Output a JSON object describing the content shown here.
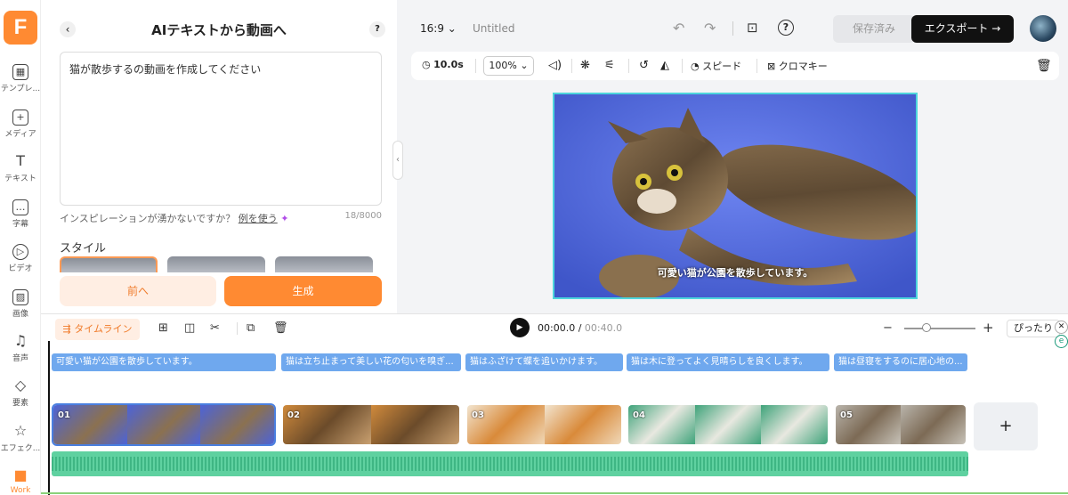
{
  "rail": {
    "items": [
      {
        "label": "テンプレ...",
        "icon": "template-icon",
        "glyph": "▦"
      },
      {
        "label": "メディア",
        "icon": "media-add-icon",
        "glyph": "+"
      },
      {
        "label": "テキスト",
        "icon": "text-icon",
        "glyph": "T"
      },
      {
        "label": "字幕",
        "icon": "subtitle-icon",
        "glyph": "…"
      },
      {
        "label": "ビデオ",
        "icon": "video-icon",
        "glyph": "▷"
      },
      {
        "label": "画像",
        "icon": "image-icon",
        "glyph": "▨"
      },
      {
        "label": "音声",
        "icon": "music-icon",
        "glyph": "♫"
      },
      {
        "label": "要素",
        "icon": "elements-icon",
        "glyph": "◇"
      },
      {
        "label": "エフェク...",
        "icon": "effects-icon",
        "glyph": "☆"
      },
      {
        "label": "Work",
        "icon": "briefcase-icon",
        "glyph": "■"
      }
    ],
    "logo_letter": "F"
  },
  "panel": {
    "title": "AIテキストから動画へ",
    "help": "?",
    "prompt_text": "猫が散歩するの動画を作成してください",
    "inspiration_text": "インスピレーションが湧かないですか？",
    "inspiration_link": "例を使う",
    "char_count": "18/8000",
    "style_label": "スタイル",
    "prev_button": "前へ",
    "generate_button": "生成"
  },
  "topbar": {
    "aspect": "16:9",
    "project_name": "Untitled",
    "saved_label": "保存済み",
    "export_label": "エクスポート"
  },
  "toolbar": {
    "duration": "10.0s",
    "zoom": "100%",
    "speed_label": "スピード",
    "chroma_label": "クロマキー"
  },
  "preview": {
    "caption": "可愛い猫が公園を散歩しています。"
  },
  "timeline": {
    "tab_label": "タイムライン",
    "current_time": "00:00.0",
    "total_time": "00:40.0",
    "fit_label": "ぴったり",
    "captions": [
      "可愛い猫が公園を散歩しています。",
      "猫は立ち止まって美しい花の匂いを嗅ぎ...",
      "猫はふざけて蝶を追いかけます。",
      "猫は木に登ってよく見晴らしを良くします。",
      "猫は昼寝をするのに居心地の..."
    ],
    "clips": [
      "01",
      "02",
      "03",
      "04",
      "05"
    ],
    "add_label": "+"
  }
}
